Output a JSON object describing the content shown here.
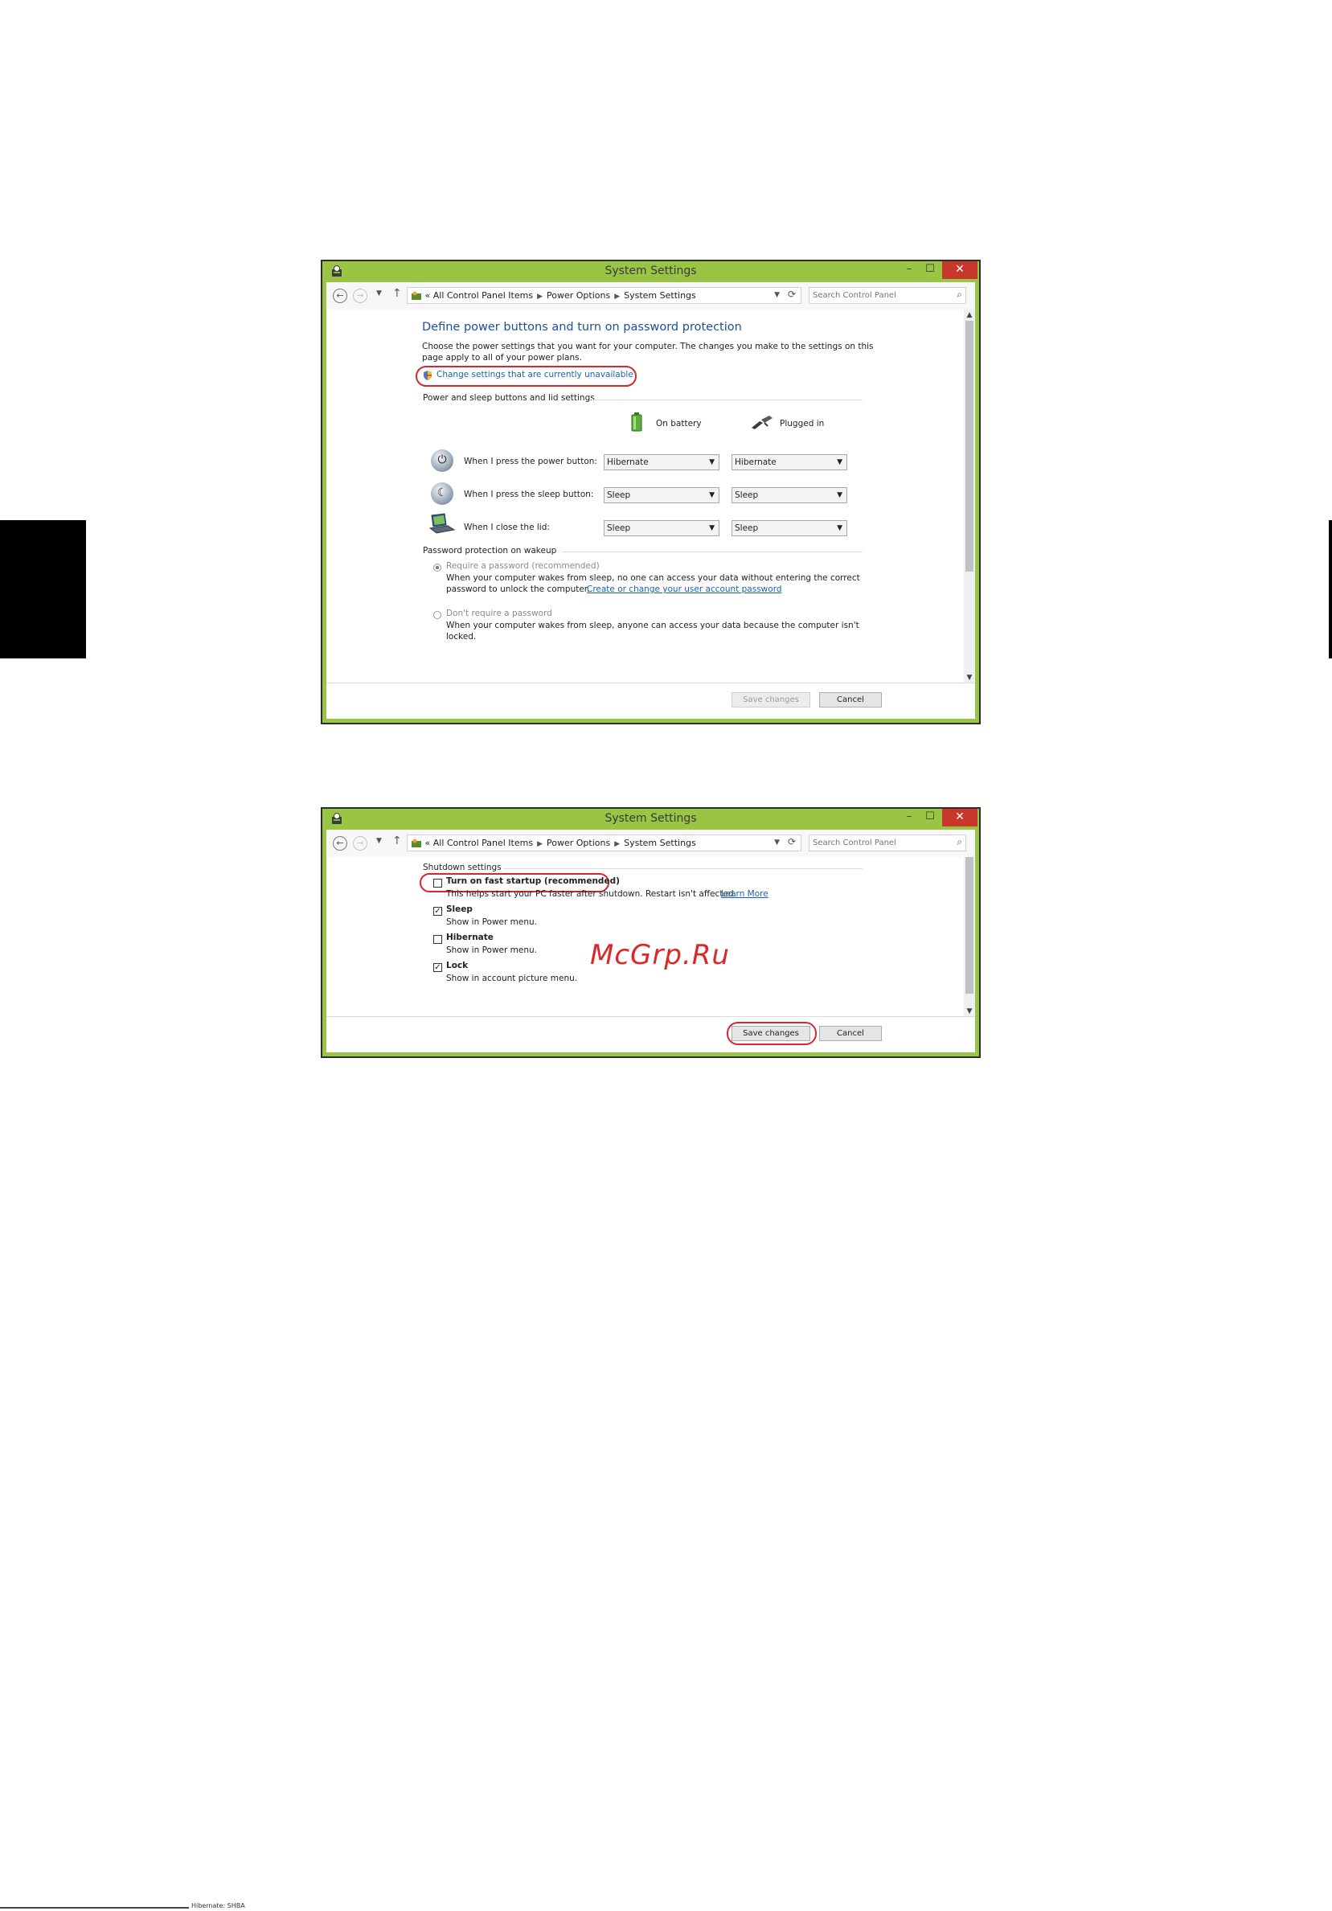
{
  "window1": {
    "title": "System Settings",
    "breadcrumb": {
      "prefix": "«",
      "items": [
        "All Control Panel Items",
        "Power Options",
        "System Settings"
      ]
    },
    "search_placeholder": "Search Control Panel",
    "heading": "Define power buttons and turn on password protection",
    "description_line1": "Choose the power settings that you want for your computer. The changes you make to the settings on this",
    "description_line2": "page apply to all of your power plans.",
    "change_settings_link": "Change settings that are currently unavailable",
    "section_buttons": "Power and sleep buttons and lid settings",
    "col_battery": "On battery",
    "col_plugged": "Plugged in",
    "rows": [
      {
        "label": "When I press the power button:",
        "battery": "Hibernate",
        "plugged": "Hibernate"
      },
      {
        "label": "When I press the sleep button:",
        "battery": "Sleep",
        "plugged": "Sleep"
      },
      {
        "label": "When I close the lid:",
        "battery": "Sleep",
        "plugged": "Sleep"
      }
    ],
    "section_password": "Password protection on wakeup",
    "require_password_label": "Require a password (recommended)",
    "require_password_desc1": "When your computer wakes from sleep, no one can access your data without entering the correct",
    "require_password_desc2": "password to unlock the computer.",
    "require_password_link": "Create or change your user account password",
    "no_password_label": "Don't require a password",
    "no_password_desc1": "When your computer wakes from sleep, anyone can access your data because the computer isn't",
    "no_password_desc2": "locked.",
    "save_label": "Save changes",
    "cancel_label": "Cancel"
  },
  "window2": {
    "title": "System Settings",
    "breadcrumb": {
      "prefix": "«",
      "items": [
        "All Control Panel Items",
        "Power Options",
        "System Settings"
      ]
    },
    "search_placeholder": "Search Control Panel",
    "section_shutdown": "Shutdown settings",
    "options": [
      {
        "label": "Turn on fast startup (recommended)",
        "desc": "This helps start your PC faster after shutdown. Restart isn't affected.",
        "link": "Learn More",
        "checked": false
      },
      {
        "label": "Sleep",
        "desc": "Show in Power menu.",
        "checked": true
      },
      {
        "label": "Hibernate",
        "desc": "Show in Power menu.",
        "checked": false
      },
      {
        "label": "Lock",
        "desc": "Show in account picture menu.",
        "checked": true
      }
    ],
    "save_label": "Save changes",
    "cancel_label": "Cancel"
  },
  "watermark": "McGrp.Ru",
  "footer_text": "Hibernate:  SHBA",
  "colors": {
    "window_frame": "#9ac443",
    "close_button": "#c7372a",
    "highlight_ring": "#d7262f",
    "link": "#1a61b5",
    "heading": "#1c4f9c"
  }
}
